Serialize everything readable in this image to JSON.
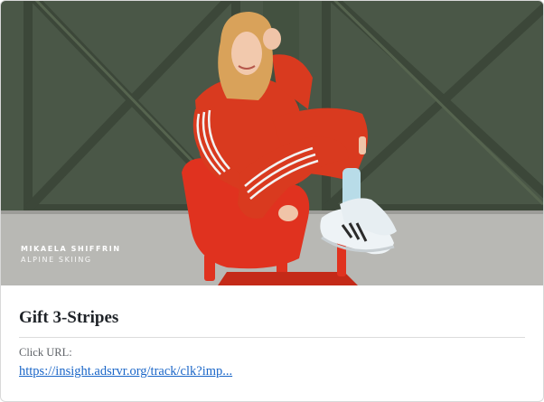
{
  "card": {
    "image_caption": {
      "name": "MIKAELA SHIFFRIN",
      "sport": "ALPINE SKIING"
    },
    "title": "Gift 3-Stripes",
    "click_url_label": "Click URL:",
    "click_url": "https://insight.adsrvr.org/track/clk?imp..."
  },
  "colors": {
    "wall": "#4a5747",
    "floor": "#b8b8b4",
    "tracksuit": "#d93a1f",
    "chair": "#e0321f",
    "link": "#1a66c8"
  }
}
